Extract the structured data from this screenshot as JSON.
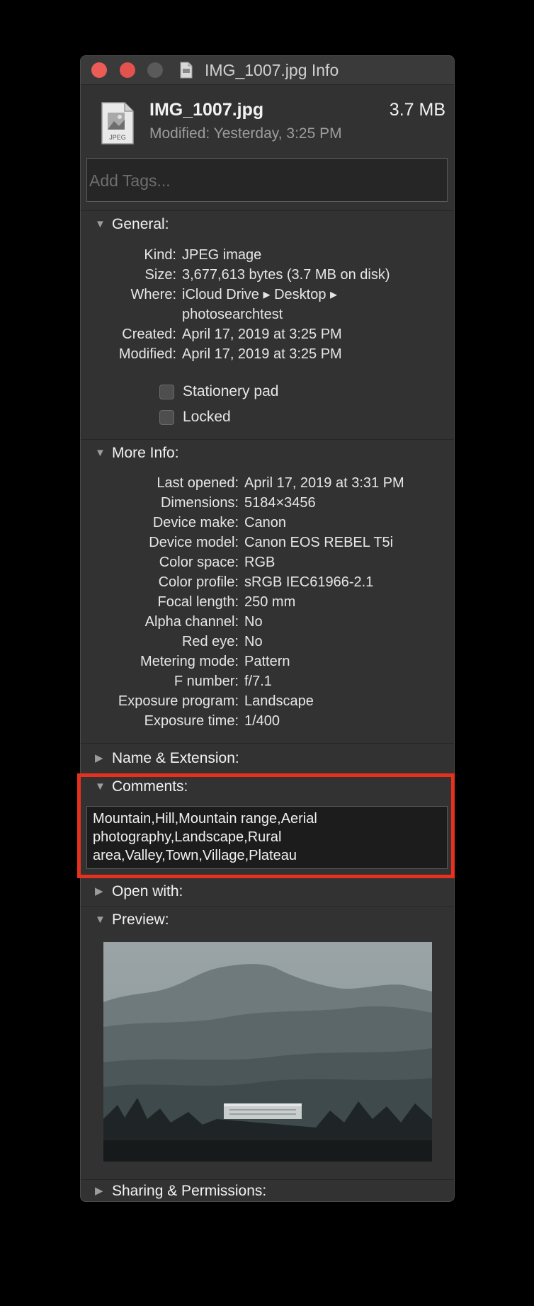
{
  "window": {
    "title": "IMG_1007.jpg Info",
    "traffic_lights": [
      "close-button",
      "minimize-button",
      "zoom-button"
    ]
  },
  "header": {
    "file_name": "IMG_1007.jpg",
    "file_size": "3.7 MB",
    "modified": "Modified: Yesterday, 3:25 PM",
    "file_icon": "jpeg-file-icon",
    "file_icon_label": "JPEG"
  },
  "tags": {
    "placeholder": "Add Tags..."
  },
  "general": {
    "heading": "General:",
    "rows": [
      {
        "label": "Kind:",
        "value": "JPEG image"
      },
      {
        "label": "Size:",
        "value": "3,677,613 bytes (3.7 MB on disk)"
      },
      {
        "label": "Where:",
        "value": "iCloud Drive ▸ Desktop ▸"
      },
      {
        "label": "",
        "value": "photosearchtest"
      },
      {
        "label": "Created:",
        "value": "April 17, 2019 at 3:25 PM"
      },
      {
        "label": "Modified:",
        "value": "April 17, 2019 at 3:25 PM"
      }
    ],
    "stationery_pad": "Stationery pad",
    "locked": "Locked"
  },
  "more_info": {
    "heading": "More Info:",
    "rows": [
      {
        "label": "Last opened:",
        "value": "April 17, 2019 at 3:31 PM"
      },
      {
        "label": "Dimensions:",
        "value": "5184×3456"
      },
      {
        "label": "Device make:",
        "value": "Canon"
      },
      {
        "label": "Device model:",
        "value": "Canon EOS REBEL T5i"
      },
      {
        "label": "Color space:",
        "value": "RGB"
      },
      {
        "label": "Color profile:",
        "value": "sRGB IEC61966-2.1"
      },
      {
        "label": "Focal length:",
        "value": "250 mm"
      },
      {
        "label": "Alpha channel:",
        "value": "No"
      },
      {
        "label": "Red eye:",
        "value": "No"
      },
      {
        "label": "Metering mode:",
        "value": "Pattern"
      },
      {
        "label": "F number:",
        "value": "f/7.1"
      },
      {
        "label": "Exposure program:",
        "value": "Landscape"
      },
      {
        "label": "Exposure time:",
        "value": "1/400"
      }
    ]
  },
  "name_extension": {
    "heading": "Name & Extension:"
  },
  "comments": {
    "heading": "Comments:",
    "text": "Mountain,Hill,Mountain range,Aerial photography,Landscape,Rural area,Valley,Town,Village,Plateau"
  },
  "open_with": {
    "heading": "Open with:"
  },
  "preview": {
    "heading": "Preview:"
  },
  "sharing": {
    "heading": "Sharing & Permissions:"
  },
  "colors": {
    "window_bg": "#323232",
    "highlight": "#e8301f",
    "close": "#ec5b55",
    "minimize": "#e3524c"
  }
}
